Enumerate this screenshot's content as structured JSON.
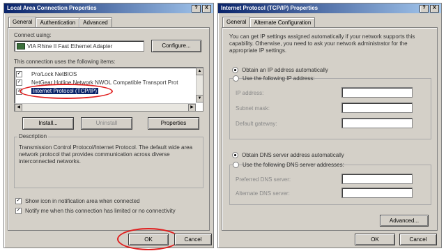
{
  "left_window": {
    "title": "Local Area Connection Properties",
    "title_buttons": [
      "?",
      "X"
    ],
    "tabs": [
      "General",
      "Authentication",
      "Advanced"
    ],
    "connect_using_label": "Connect using:",
    "adapter_name": "VIA Rhine II Fast Ethernet Adapter",
    "configure_label": "Configure...",
    "components_label": "This connection uses the following items:",
    "components": [
      {
        "label": "Pro/Lock NetBIOS",
        "checked": true
      },
      {
        "label": "NetGear Hotline Network NWOL Compatible Transport Prot",
        "checked": true
      },
      {
        "label": "Internet Protocol (TCP/IP)",
        "checked": true,
        "selected": true
      }
    ],
    "install_label": "Install...",
    "uninstall_label": "Uninstall",
    "properties_label": "Properties",
    "description_title": "Description",
    "description_text": "Transmission Control Protocol/Internet Protocol. The default wide area network protocol that provides communication across diverse interconnected networks.",
    "show_icon_label": "Show icon in notification area when connected",
    "notify_label": "Notify me when this connection has limited or no connectivity",
    "ok_label": "OK",
    "cancel_label": "Cancel",
    "highlight_color": "#e02020"
  },
  "right_window": {
    "title": "Internet Protocol (TCP/IP) Properties",
    "title_buttons": [
      "?",
      "X"
    ],
    "tabs": [
      "General",
      "Alternate Configuration"
    ],
    "intro_text": "You can get IP settings assigned automatically if your network supports this capability. Otherwise, you need to ask your network administrator for the appropriate IP settings.",
    "obtain_ip_auto": "Obtain an IP address automatically",
    "use_following_ip": "Use the following IP address:",
    "ip_address_label": "IP address:",
    "subnet_mask_label": "Subnet mask:",
    "default_gateway_label": "Default gateway:",
    "obtain_dns_auto": "Obtain DNS server address automatically",
    "use_following_dns": "Use the following DNS server addresses:",
    "preferred_dns_label": "Preferred DNS server:",
    "alternate_dns_label": "Alternate DNS server:",
    "advanced_label": "Advanced...",
    "ok_label": "OK",
    "cancel_label": "Cancel"
  }
}
